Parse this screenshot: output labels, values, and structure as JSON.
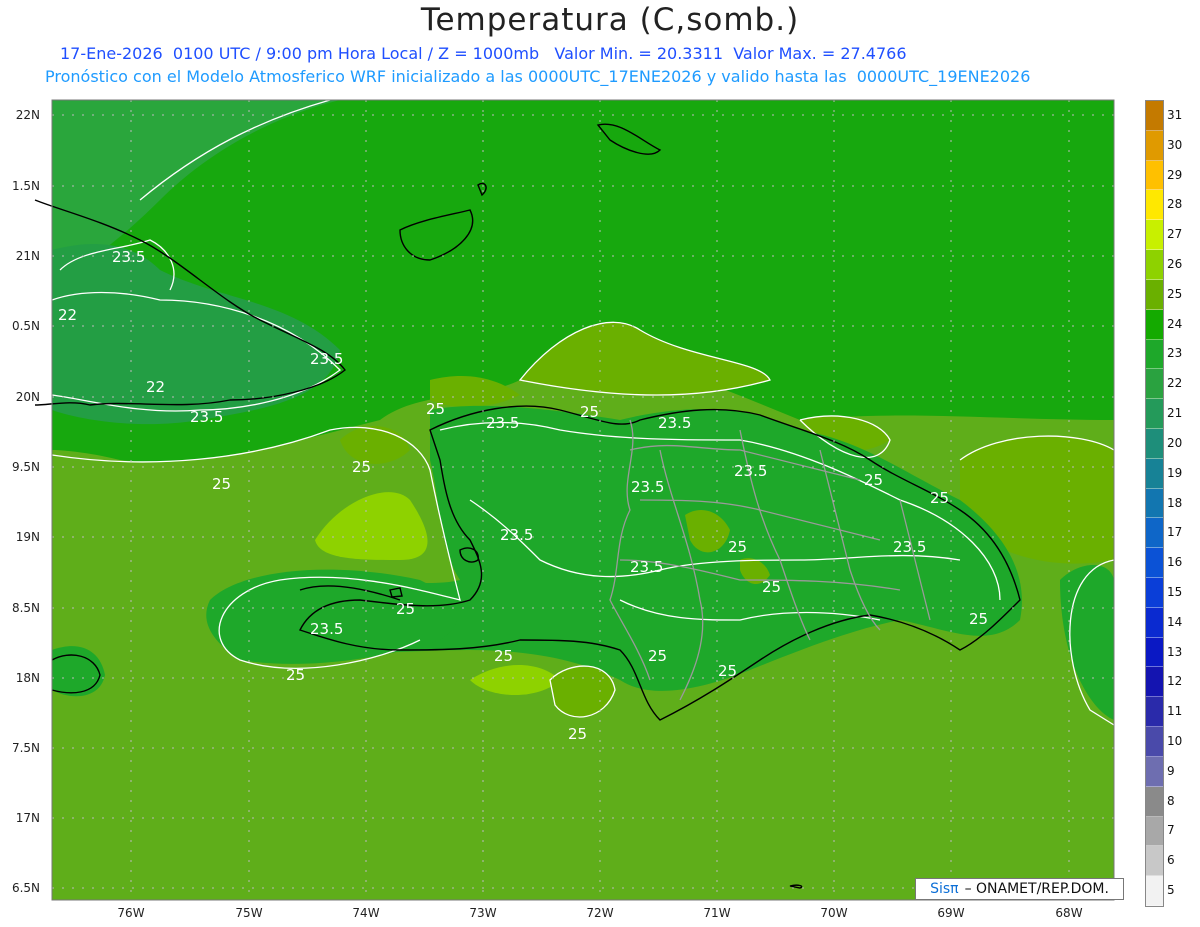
{
  "header": {
    "title": "Temperatura (C,somb.)",
    "subtitle_line1": "17-Ene-2026  0100 UTC / 9:00 pm Hora Local / Z = 1000mb   Valor Min. = 20.3311  Valor Max. = 27.4766",
    "subtitle_line2": "Pronóstico con el Modelo Atmosferico WRF inicializado a las 0000UTC_17ENE2026 y valido hasta las  0000UTC_19ENE2026"
  },
  "axes": {
    "lat_labels": [
      "22N",
      "1.5N",
      "21N",
      "0.5N",
      "20N",
      "9.5N",
      "19N",
      "8.5N",
      "18N",
      "7.5N",
      "17N",
      "6.5N"
    ],
    "lon_labels": [
      "76W",
      "75W",
      "74W",
      "73W",
      "72W",
      "71W",
      "70W",
      "69W",
      "68W"
    ]
  },
  "colorbar": {
    "labels": [
      "31",
      "30",
      "29",
      "28",
      "27",
      "26",
      "25",
      "24",
      "23",
      "22",
      "21",
      "20",
      "19",
      "18",
      "17",
      "16",
      "15",
      "14",
      "13",
      "12",
      "11",
      "10",
      "9",
      "8",
      "7",
      "6",
      "5"
    ],
    "colors": [
      "#c47a00",
      "#e09a00",
      "#ffc000",
      "#ffe800",
      "#c8f000",
      "#8ed200",
      "#6ab000",
      "#14aa00",
      "#1ea82a",
      "#2aa240",
      "#249a5a",
      "#1e8e7a",
      "#178296",
      "#1276b0",
      "#0e66c8",
      "#0b52d6",
      "#0a3ed8",
      "#0a2ad0",
      "#0a18c4",
      "#1414b0",
      "#2a2aaa",
      "#4a4aaa",
      "#6e6eb0",
      "#8a8a8a",
      "#a8a8a8",
      "#c8c8c8",
      "#f2f2f2"
    ]
  },
  "contour_labels": [
    "23.5",
    "22",
    "23.5",
    "22",
    "23.5",
    "25",
    "25",
    "25",
    "23.5",
    "25",
    "23.5",
    "23.5",
    "25",
    "25",
    "23.5",
    "23.5",
    "25",
    "23.5",
    "25",
    "23.5",
    "25",
    "25",
    "25",
    "25",
    "25",
    "23.5",
    "25",
    "25"
  ],
  "brand": {
    "logo_text": "Sisπ",
    "org_text": "– ONAMET/REP.DOM."
  }
}
